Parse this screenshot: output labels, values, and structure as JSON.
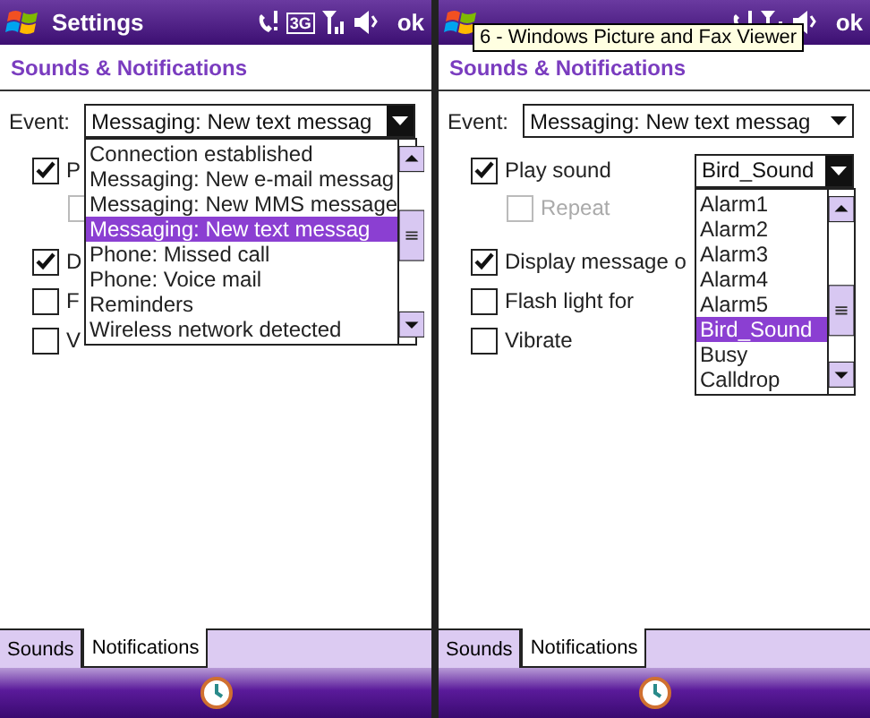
{
  "screens": [
    {
      "title": "Settings",
      "status": {
        "network": "3G"
      },
      "ok": "ok",
      "header": "Sounds & Notifications",
      "event": {
        "label": "Event:",
        "value": "Messaging: New text messag",
        "focused": true,
        "open": true,
        "options": [
          {
            "label": "Connection established",
            "selected": false
          },
          {
            "label": "Messaging: New e-mail messag",
            "selected": false
          },
          {
            "label": "Messaging: New MMS message",
            "selected": false
          },
          {
            "label": "Messaging: New text messag",
            "selected": true
          },
          {
            "label": "Phone: Missed call",
            "selected": false
          },
          {
            "label": "Phone: Voice mail",
            "selected": false
          },
          {
            "label": "Reminders",
            "selected": false
          },
          {
            "label": "Wireless network detected",
            "selected": false
          }
        ]
      },
      "options": [
        {
          "kind": "checkbox",
          "label": "P",
          "checked": true
        },
        {
          "kind": "sub_checkbox",
          "disabled": true
        },
        {
          "kind": "checkbox",
          "label": "D",
          "checked": true
        },
        {
          "kind": "checkbox",
          "label": "F",
          "checked": false
        },
        {
          "kind": "checkbox",
          "label": "V",
          "checked": false
        }
      ],
      "tabs": [
        {
          "label": "Sounds",
          "selected": false
        },
        {
          "label": "Notifications",
          "selected": true
        }
      ]
    },
    {
      "ok": "ok",
      "tooltip": "6 - Windows Picture and Fax Viewer",
      "header": "Sounds & Notifications",
      "event": {
        "label": "Event:",
        "value": "Messaging: New text messag",
        "focused": false,
        "open": false
      },
      "options": [
        {
          "kind": "sound_checkbox",
          "label": "Play sound",
          "checked": true,
          "sound": {
            "value": "Bird_Sound",
            "focused": true,
            "open": true,
            "options": [
              {
                "label": "Alarm1",
                "selected": false
              },
              {
                "label": "Alarm2",
                "selected": false
              },
              {
                "label": "Alarm3",
                "selected": false
              },
              {
                "label": "Alarm4",
                "selected": false
              },
              {
                "label": "Alarm5",
                "selected": false
              },
              {
                "label": "Bird_Sound",
                "selected": true
              },
              {
                "label": "Busy",
                "selected": false
              },
              {
                "label": "Calldrop",
                "selected": false
              }
            ]
          }
        },
        {
          "kind": "sub_checkbox",
          "label": "Repeat",
          "checked": false,
          "disabled": true
        },
        {
          "kind": "checkbox",
          "label": "Display message o",
          "checked": true
        },
        {
          "kind": "checkbox",
          "label": "Flash light for",
          "checked": false
        },
        {
          "kind": "checkbox",
          "label": "Vibrate",
          "checked": false
        }
      ],
      "tabs": [
        {
          "label": "Sounds",
          "selected": false
        },
        {
          "label": "Notifications",
          "selected": true
        }
      ]
    }
  ]
}
